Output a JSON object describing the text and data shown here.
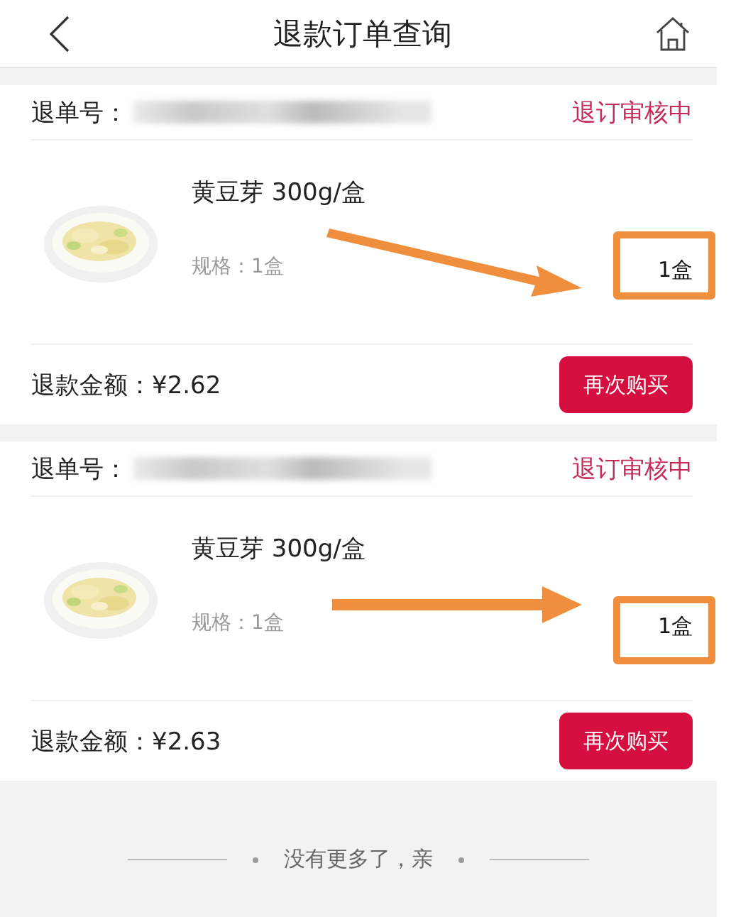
{
  "header": {
    "title": "退款订单查询"
  },
  "orders": [
    {
      "order_label": "退单号：",
      "status": "退订审核中",
      "product_name": "黄豆芽 300g/盒",
      "spec": "规格：1盒",
      "quantity": "1盒",
      "quantity_highlighted": true,
      "arrow": {
        "kind": "diagonal"
      },
      "amount": "退款金额：¥2.62",
      "button": "再次购买"
    },
    {
      "order_label": "退单号：",
      "status": "退订审核中",
      "product_name": "黄豆芽 300g/盒",
      "spec": "规格：1盒",
      "quantity": "1盒",
      "quantity_highlighted": true,
      "arrow": {
        "kind": "straight"
      },
      "amount": "退款金额：¥2.63",
      "button": "再次购买"
    }
  ],
  "list_end": "没有更多了，亲"
}
